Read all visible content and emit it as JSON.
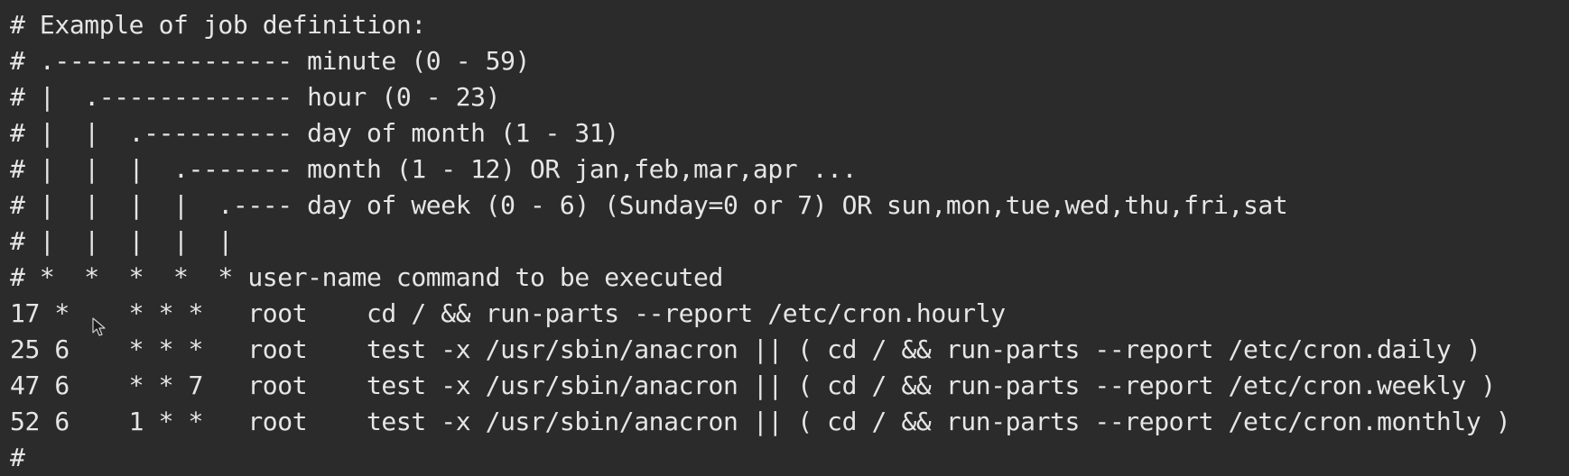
{
  "editor": {
    "lines": [
      "# Example of job definition:",
      "# .---------------- minute (0 - 59)",
      "# |  .------------- hour (0 - 23)",
      "# |  |  .---------- day of month (1 - 31)",
      "# |  |  |  .------- month (1 - 12) OR jan,feb,mar,apr ...",
      "# |  |  |  |  .---- day of week (0 - 6) (Sunday=0 or 7) OR sun,mon,tue,wed,thu,fri,sat",
      "# |  |  |  |  |",
      "# *  *  *  *  * user-name command to be executed",
      "17 *    * * *   root    cd / && run-parts --report /etc/cron.hourly",
      "25 6    * * *   root    test -x /usr/sbin/anacron || ( cd / && run-parts --report /etc/cron.daily )",
      "47 6    * * 7   root    test -x /usr/sbin/anacron || ( cd / && run-parts --report /etc/cron.weekly )",
      "52 6    1 * *   root    test -x /usr/sbin/anacron || ( cd / && run-parts --report /etc/cron.monthly )",
      "#"
    ]
  },
  "cursor": {
    "icon": "mouse-pointer-icon"
  },
  "colors": {
    "background": "#2b2b2b",
    "text": "#e6e6e6"
  }
}
